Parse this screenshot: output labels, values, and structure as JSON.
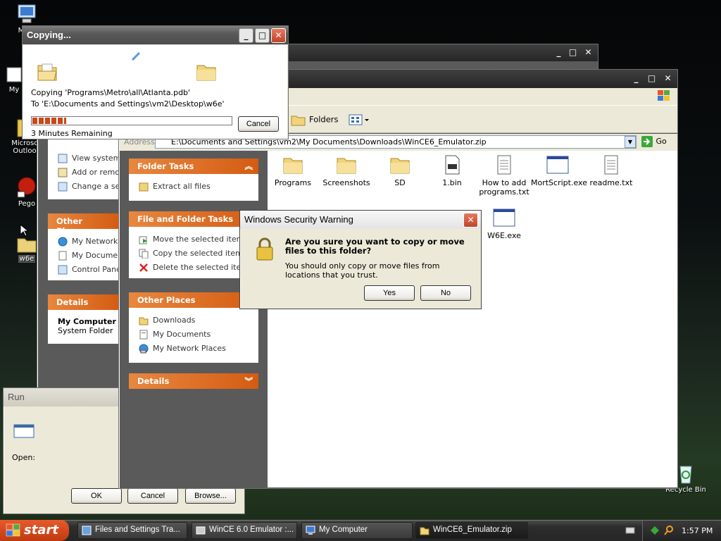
{
  "desktop": {
    "icons": [
      {
        "label": "My C"
      },
      {
        "label": "My"
      },
      {
        "label": "Microsc Outloo"
      },
      {
        "label": "Pego"
      },
      {
        "label": "w6e"
      },
      {
        "label": "Recycle Bin"
      }
    ]
  },
  "copy_dialog": {
    "title": "Copying...",
    "line1": "Copying 'Programs\\Metro\\all\\Atlanta.pdb'",
    "line2": "To 'E:\\Documents and Settings\\vm2\\Desktop\\w6e'",
    "remaining": "3 Minutes Remaining",
    "cancel": "Cancel",
    "progress": 0.17
  },
  "back_window": {
    "left_items": [
      "View system",
      "Add or remov",
      "Change a se"
    ],
    "other_places_title": "Other Places",
    "other_places": [
      "My Network",
      "My Documen",
      "Control Pane"
    ],
    "details_title": "Details",
    "details_name": "My Computer",
    "details_type": "System Folder"
  },
  "explorer": {
    "toolbar_folders": "Folders",
    "address_label": "Address",
    "address": "E:\\Documents and Settings\\vm2\\My Documents\\Downloads\\WinCE6_Emulator.zip",
    "go": "Go",
    "folder_tasks_title": "Folder Tasks",
    "folder_tasks": [
      "Extract all files"
    ],
    "file_tasks_title": "File and Folder Tasks",
    "file_tasks": [
      "Move the selected items",
      "Copy the selected items",
      "Delete the selected items"
    ],
    "other_title": "Other Places",
    "other": [
      "Downloads",
      "My Documents",
      "My Network Places"
    ],
    "details_title": "Details",
    "files": [
      "Programs",
      "Screenshots",
      "SD",
      "1.bin",
      "How to add programs.txt",
      "MortScript.exe",
      "readme.txt",
      "W6E.exe"
    ]
  },
  "security": {
    "title": "Windows Security Warning",
    "question": "Are you sure you want to copy or move files to this folder?",
    "note": "You should only copy or move files from locations that you trust.",
    "yes": "Yes",
    "no": "No"
  },
  "run": {
    "title": "Run",
    "open_label": "Open:",
    "ok": "OK",
    "cancel": "Cancel",
    "browse": "Browse..."
  },
  "taskbar": {
    "start": "start",
    "tasks": [
      "Files and Settings Tra...",
      "WinCE 6.0 Emulator :...",
      "My Computer",
      "WinCE6_Emulator.zip"
    ],
    "clock": "1:57 PM"
  }
}
